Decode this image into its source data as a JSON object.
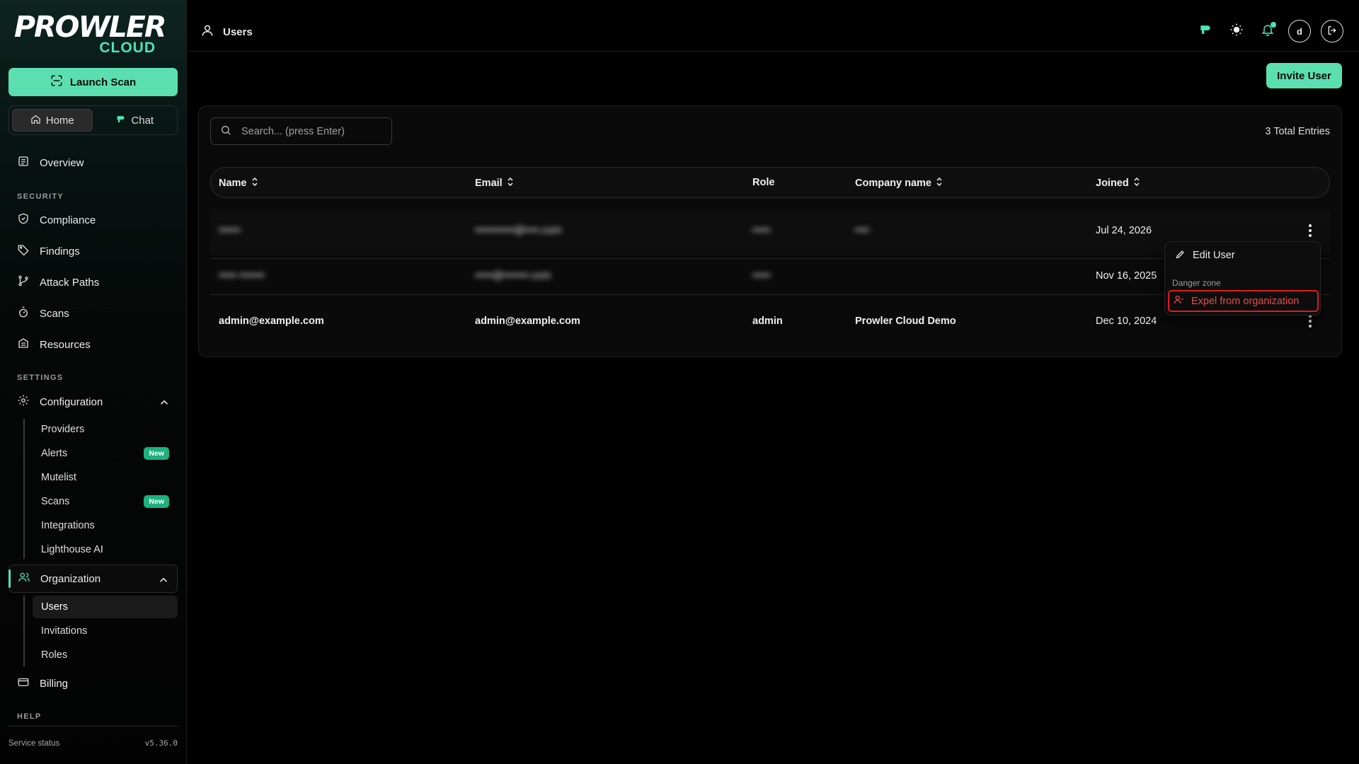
{
  "brand": {
    "wordmark": "PROWLER",
    "sub": "CLOUD",
    "accent": "#5bdfb1"
  },
  "sidebar": {
    "launch_label": "Launch Scan",
    "segment": {
      "home": "Home",
      "chat": "Chat"
    },
    "overview": "Overview",
    "security_label": "SECURITY",
    "security_items": [
      "Compliance",
      "Findings",
      "Attack Paths",
      "Scans",
      "Resources"
    ],
    "settings_label": "SETTINGS",
    "configuration": "Configuration",
    "config_items": [
      {
        "label": "Providers",
        "badge": ""
      },
      {
        "label": "Alerts",
        "badge": "New"
      },
      {
        "label": "Mutelist",
        "badge": ""
      },
      {
        "label": "Scans",
        "badge": "New"
      },
      {
        "label": "Integrations",
        "badge": ""
      },
      {
        "label": "Lighthouse AI",
        "badge": ""
      }
    ],
    "organization": "Organization",
    "org_items": [
      "Users",
      "Invitations",
      "Roles"
    ],
    "billing": "Billing",
    "help_label": "HELP",
    "service_status": "Service status",
    "version": "v5.36.0"
  },
  "topbar": {
    "title": "Users",
    "avatar_letter": "d"
  },
  "main": {
    "invite_label": "Invite User",
    "search_placeholder": "Search... (press Enter)",
    "total_entries": "3 Total Entries",
    "columns": [
      "Name",
      "Email",
      "Role",
      "Company name",
      "Joined"
    ],
    "rows": [
      {
        "name": "••••••",
        "email": "•••••••••••@••••.com",
        "role": "•••••",
        "company": "••••",
        "joined": "Jul 24, 2026",
        "redacted": true
      },
      {
        "name": "••••• •••••••",
        "email": "•••••@•••••••.com",
        "role": "•••••",
        "company": "",
        "joined": "Nov 16, 2025",
        "redacted": true
      },
      {
        "name": "admin@example.com",
        "email": "admin@example.com",
        "role": "admin",
        "company": "Prowler Cloud Demo",
        "joined": "Dec 10, 2024",
        "redacted": false
      }
    ]
  },
  "menu": {
    "edit_label": "Edit User",
    "danger_label": "Danger zone",
    "expel_label": "Expel from organization"
  }
}
